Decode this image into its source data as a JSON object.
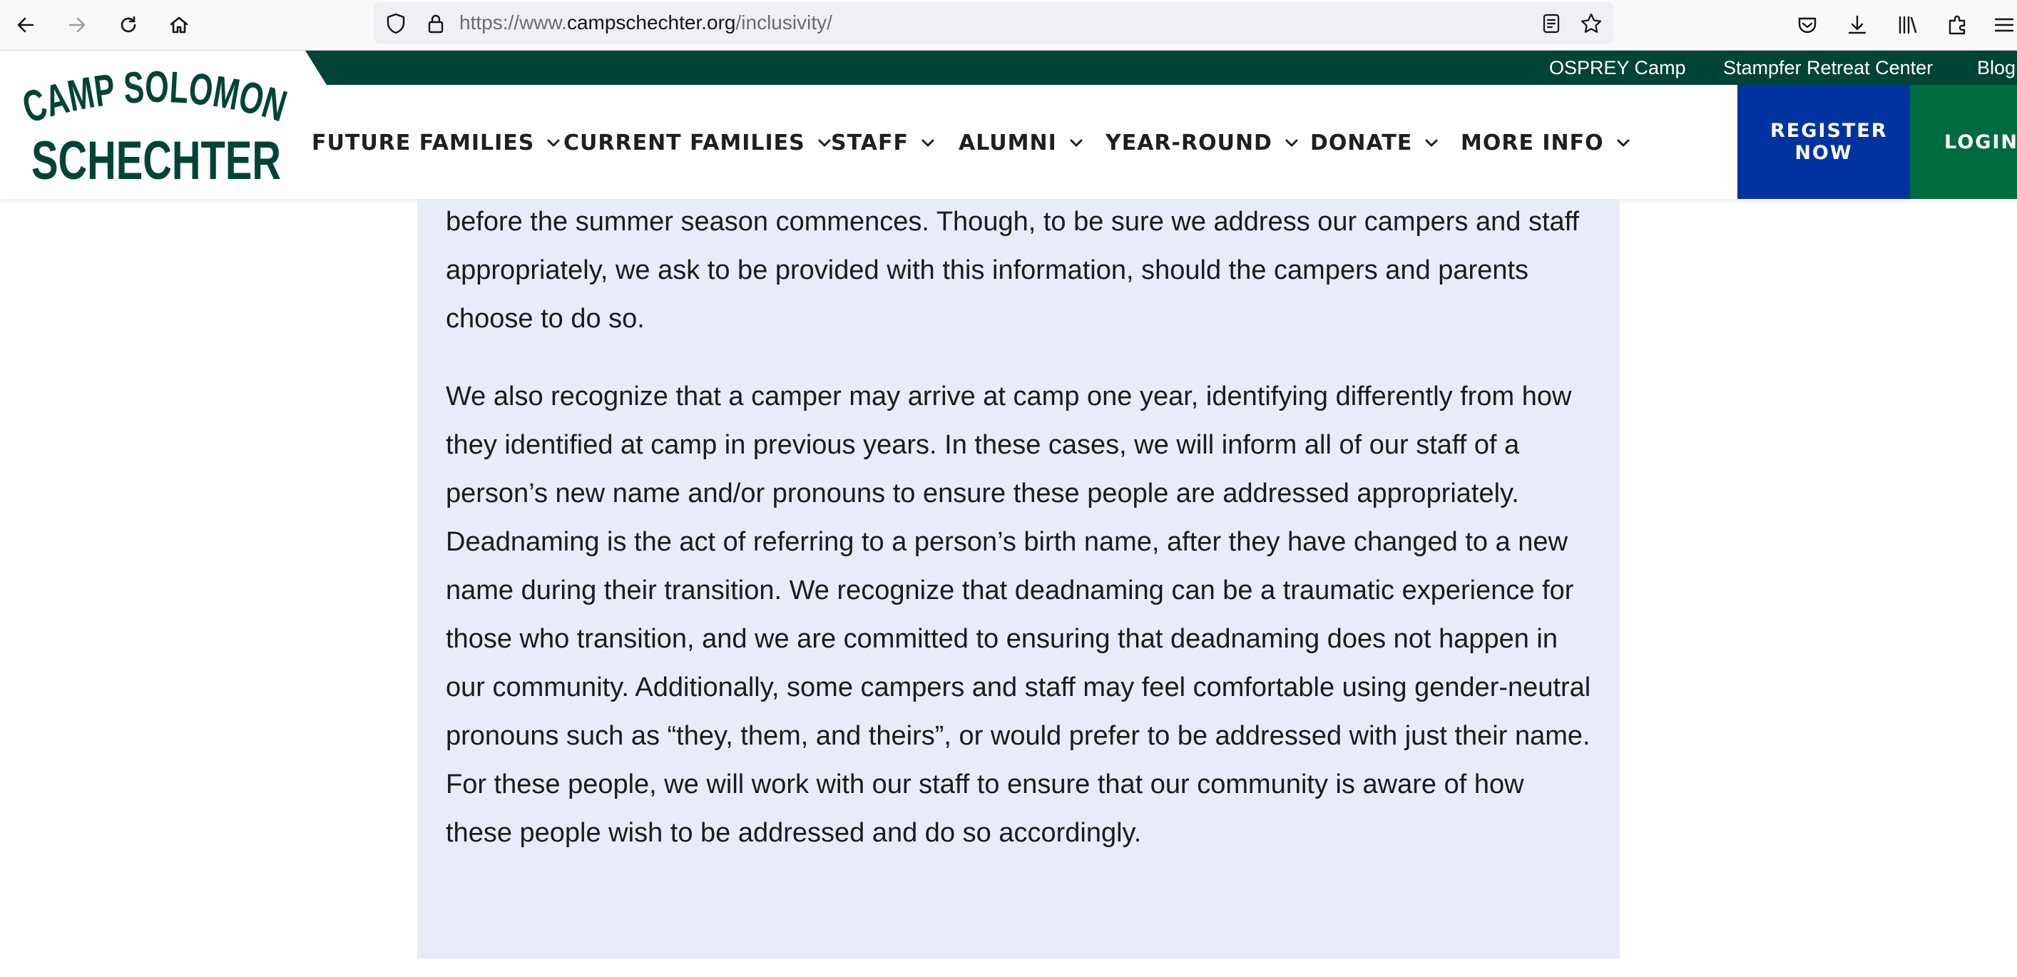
{
  "browser": {
    "url_prefix": "https://www.",
    "url_host": "campschechter.org",
    "url_path": "/inclusivity/",
    "icons": [
      "back-icon",
      "forward-icon",
      "reload-icon",
      "home-icon",
      "shield-icon",
      "lock-icon",
      "reader-view-icon",
      "bookmark-star-icon",
      "pocket-icon",
      "download-icon",
      "library-icon",
      "extensions-icon",
      "menu-icon"
    ]
  },
  "header": {
    "logo_line1": "CAMP SOLOMON",
    "logo_line2": "SCHECHTER",
    "utility_links": [
      "OSPREY Camp",
      "Stampfer Retreat Center",
      "Blog"
    ],
    "nav": [
      "FUTURE FAMILIES",
      "CURRENT FAMILIES",
      "STAFF",
      "ALUMNI",
      "YEAR-ROUND",
      "DONATE",
      "MORE INFO"
    ],
    "register_label": "REGISTER NOW",
    "login_label": "LOGIN",
    "colors": {
      "brand_green": "#004436",
      "register_blue": "#0033a0",
      "login_green": "#006b3f"
    }
  },
  "content": {
    "background": "#e7ecf8",
    "paragraphs": [
      "before the summer season commences. Though, to be sure we address our campers and staff appropriately, we ask to be provided with this information, should the campers and parents choose to do so.",
      "We also recognize that a camper may arrive at camp one year, identifying differently from how they identified at camp in previous years. In these cases, we will inform all of our staff of a person’s new name and/or pronouns to ensure these people are addressed appropriately. Deadnaming is the act of referring to a person’s birth name, after they have changed to a new name during their transition. We recognize that deadnaming can be a traumatic experience for those who transition, and we are committed to ensuring that deadnaming does not happen in our community. Additionally, some campers and staff may feel comfortable using gender-neutral pronouns such as “they, them, and theirs”, or would prefer to be addressed with just their name. For these people, we will work with our staff to ensure that our community is aware of how these people wish to be addressed and do so accordingly."
    ]
  }
}
